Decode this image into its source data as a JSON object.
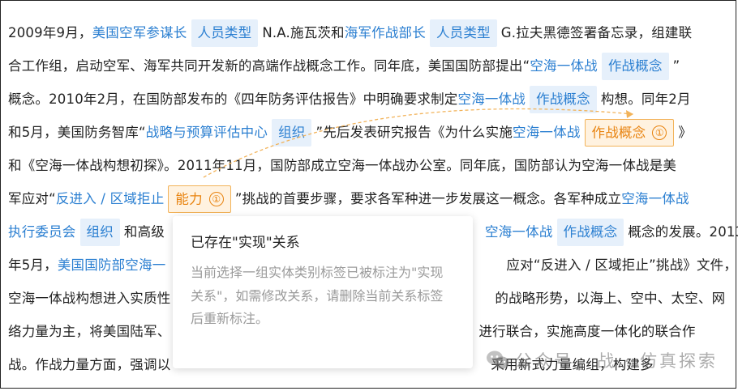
{
  "doc": {
    "lines": [
      [
        {
          "t": "2009年9月，"
        },
        {
          "t": "美国空军参谋长",
          "k": "ent"
        },
        {
          "t": "人员类型",
          "k": "tag"
        },
        {
          "t": "N.A.施瓦茨和"
        },
        {
          "t": "海军作战部长",
          "k": "ent"
        },
        {
          "t": "人员类型",
          "k": "tag"
        },
        {
          "t": "G.拉夫黑德签署备忘录，组建联"
        }
      ],
      [
        {
          "t": "合工作组，启动空军、海军共同开发新的高端作战概念工作。同年底，美国国防部提出“"
        },
        {
          "t": "空海一体战",
          "k": "ent"
        },
        {
          "t": "作战概念",
          "k": "tag"
        },
        {
          "t": "”"
        }
      ],
      [
        {
          "t": "概念。2010年2月，在国防部发布的《四年防务评估报告》中明确要求制定"
        },
        {
          "t": "空海一体战",
          "k": "ent"
        },
        {
          "t": "作战概念",
          "k": "tag"
        },
        {
          "t": "构想。同年2月"
        }
      ],
      [
        {
          "t": "和5月，美国防务智库“"
        },
        {
          "t": "战略与预算评估中心",
          "k": "ent"
        },
        {
          "t": "组织",
          "k": "tag"
        },
        {
          "t": "”先后发表研究报告《为什么实施"
        },
        {
          "t": "空海一体战",
          "k": "ent"
        },
        {
          "t": "作战概念",
          "k": "otag",
          "n": "①"
        },
        {
          "t": "》"
        }
      ],
      [
        {
          "t": "和《空海一体战构想初探》。2011年11月，国防部成立空海一体战办公室。同年底，国防部认为空海一体战是美"
        }
      ],
      [
        {
          "t": "军应对“"
        },
        {
          "t": "反进入 / 区域拒止",
          "k": "ent"
        },
        {
          "t": "能力",
          "k": "otag",
          "n": "①"
        },
        {
          "t": "”挑战的首要步骤，要求各军种进一步发展这一概念。各军种成立"
        },
        {
          "t": "空海一体战",
          "k": "ent"
        }
      ],
      [
        {
          "t": "执行委员会",
          "k": "ent"
        },
        {
          "t": "组织",
          "k": "tag"
        },
        {
          "t": "和高级",
          "gap": 395
        },
        {
          "t": "空海一体战",
          "k": "ent"
        },
        {
          "t": "作战概念",
          "k": "tag"
        },
        {
          "t": "概念的发展。2013"
        }
      ],
      [
        {
          "t": "年5月，"
        },
        {
          "t": "美国国防部空海一",
          "k": "ent",
          "gap": 420
        },
        {
          "t": "应对“反进入 / 区域拒止”挑战》文件，"
        }
      ],
      [
        {
          "t": "空海一体战构想进入实质性",
          "gap": 400
        },
        {
          "t": "的战略形势，以海上、空中、太空、网"
        }
      ],
      [
        {
          "t": "络力量为主，将美国陆军、",
          "gap": 380
        },
        {
          "t": "进行联合，实施高度一体化的联合作"
        }
      ],
      [
        {
          "t": "战。作战力量方面，强调以",
          "gap": 395
        },
        {
          "t": "采用新式力量编组，构建多"
        }
      ]
    ]
  },
  "popup": {
    "title": "已存在\"实现\"关系",
    "body": "当前选择一组实体类别标签已被标注为\"实现关系\"，如需修改关系，请删除当前关系标签后重新标注。"
  },
  "watermark": {
    "icon": "wechat-icon",
    "text": "公众号 · 战 · 仿真探索"
  },
  "colors": {
    "entity_blue": "#2b7fd1",
    "tag_bg": "#e6f0fb",
    "selected_orange": "#e8830f",
    "selected_bg": "#fff2e0"
  }
}
